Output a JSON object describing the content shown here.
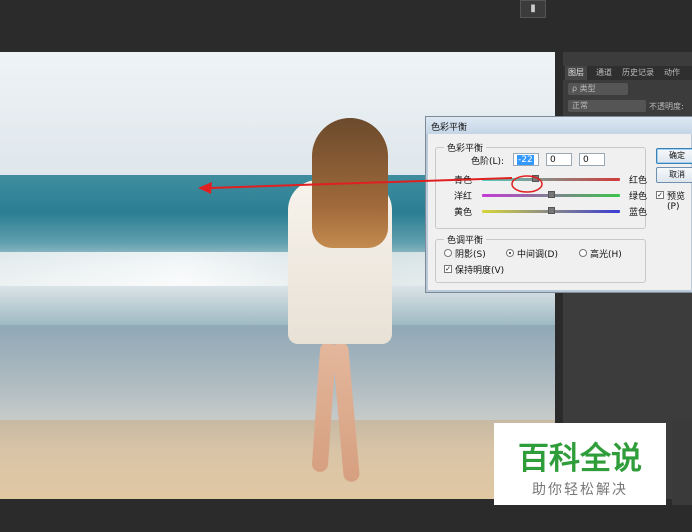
{
  "dialog": {
    "title": "色彩平衡",
    "balance_group": "色彩平衡",
    "levels_label": "色阶(L):",
    "levels": [
      "-22",
      "0",
      "0"
    ],
    "sliders": [
      {
        "left": "青色",
        "right": "红色",
        "value": -22,
        "track_color": "linear-gradient(90deg,#4fd1c5,#d23a3a)"
      },
      {
        "left": "洋红",
        "right": "绿色",
        "value": 0,
        "track_color": "linear-gradient(90deg,#c43bd6,#3bc44b)"
      },
      {
        "left": "黄色",
        "right": "蓝色",
        "value": 0,
        "track_color": "linear-gradient(90deg,#d6d63b,#3b3bd6)"
      }
    ],
    "tone_group": "色调平衡",
    "tones": [
      {
        "label": "阴影(S)",
        "selected": false
      },
      {
        "label": "中间调(D)",
        "selected": true
      },
      {
        "label": "高光(H)",
        "selected": false
      }
    ],
    "preserve_luminosity": "保持明度(V)",
    "preserve_checked": true,
    "ok_button": "确定",
    "cancel_button": "取消",
    "preview_label": "预览(P)",
    "preview_checked": true
  },
  "panel": {
    "tabs": [
      "图层",
      "通道",
      "历史记录",
      "动作"
    ],
    "filter_label": "ρ 类型",
    "blend_mode": "正常",
    "opacity_label": "不透明度:"
  },
  "watermark": {
    "title": "百科全说",
    "subtitle": "助你轻松解决"
  },
  "colors": {
    "annotation_red": "#e02020",
    "watermark_green": "#2f9e3a"
  }
}
